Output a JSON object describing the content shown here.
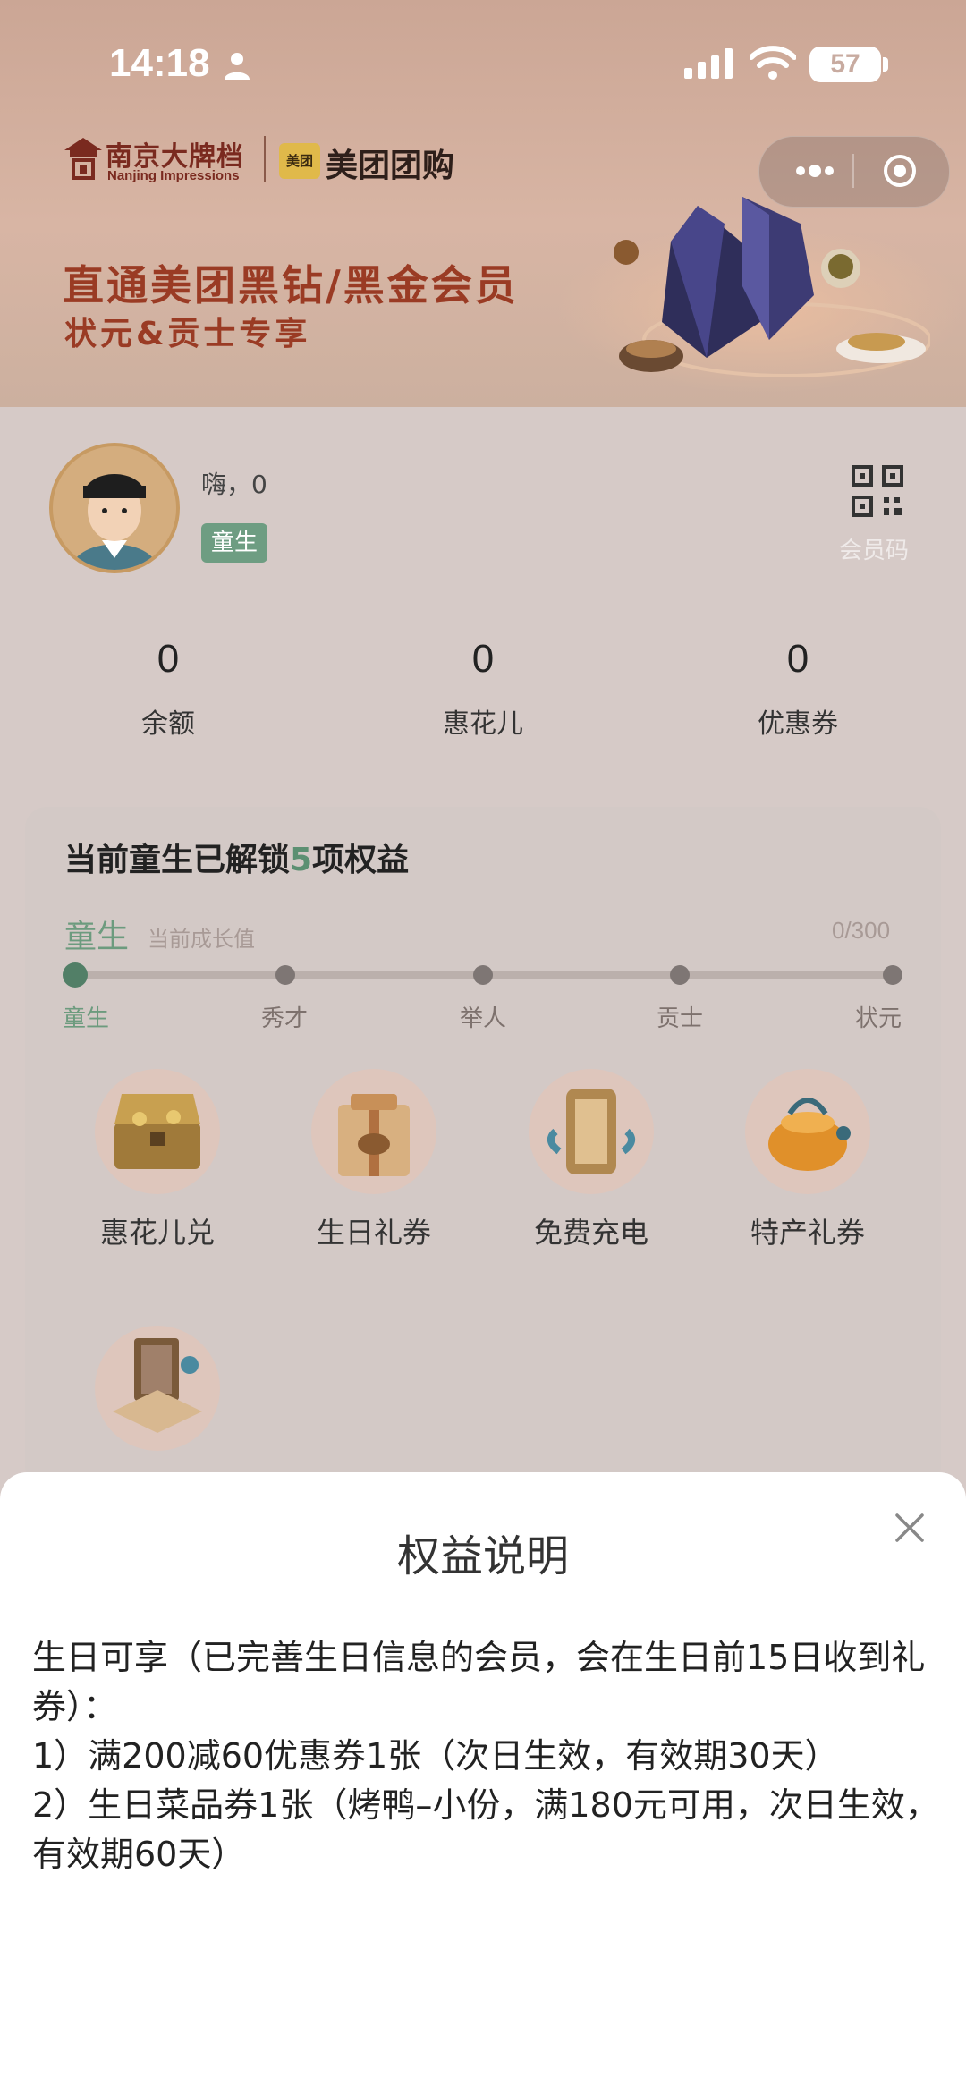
{
  "status_bar": {
    "time": "14:18",
    "battery": "57"
  },
  "banner": {
    "brand_cn": "南京大牌档",
    "brand_en": "Nanjing Impressions",
    "partner_badge": "美团",
    "partner_name": "美团团购",
    "title": "直通美团黑钻/黑金会员",
    "subtitle": "状元&贡士专享"
  },
  "profile": {
    "greeting": "嗨，0",
    "level_badge": "童生",
    "qr_label": "会员码"
  },
  "stats": [
    {
      "value": "0",
      "label": "余额"
    },
    {
      "value": "0",
      "label": "惠花儿"
    },
    {
      "value": "0",
      "label": "优惠券"
    }
  ],
  "rights": {
    "title_prefix": "当前童生已解锁",
    "title_count": "5",
    "title_suffix": "项权益",
    "current_level": "童生",
    "growth_label": "当前成长值",
    "growth_value": "0/300",
    "growth_progress": 0,
    "levels": [
      "童生",
      "秀才",
      "举人",
      "贡士",
      "状元"
    ],
    "benefits": [
      {
        "label": "惠花儿兑",
        "icon": "treasure-chest-icon"
      },
      {
        "label": "生日礼券",
        "icon": "gift-box-icon"
      },
      {
        "label": "免费充电",
        "icon": "lantern-charger-icon"
      },
      {
        "label": "特产礼券",
        "icon": "specialty-gift-icon"
      },
      {
        "label": "",
        "icon": "book-box-icon"
      }
    ]
  },
  "sheet": {
    "title": "权益说明",
    "lines": [
      "生日可享（已完善生日信息的会员，会在生日前15日收到礼券）：",
      "1）满200减60优惠券1张（次日生效，有效期30天）",
      "2）生日菜品券1张（烤鸭–小份，满180元可用，次日生效，有效期60天）"
    ]
  },
  "colors": {
    "level_green": "#6c9b7e",
    "banner_red": "#9a3b24",
    "overlay_bg": "#d6cac7"
  }
}
